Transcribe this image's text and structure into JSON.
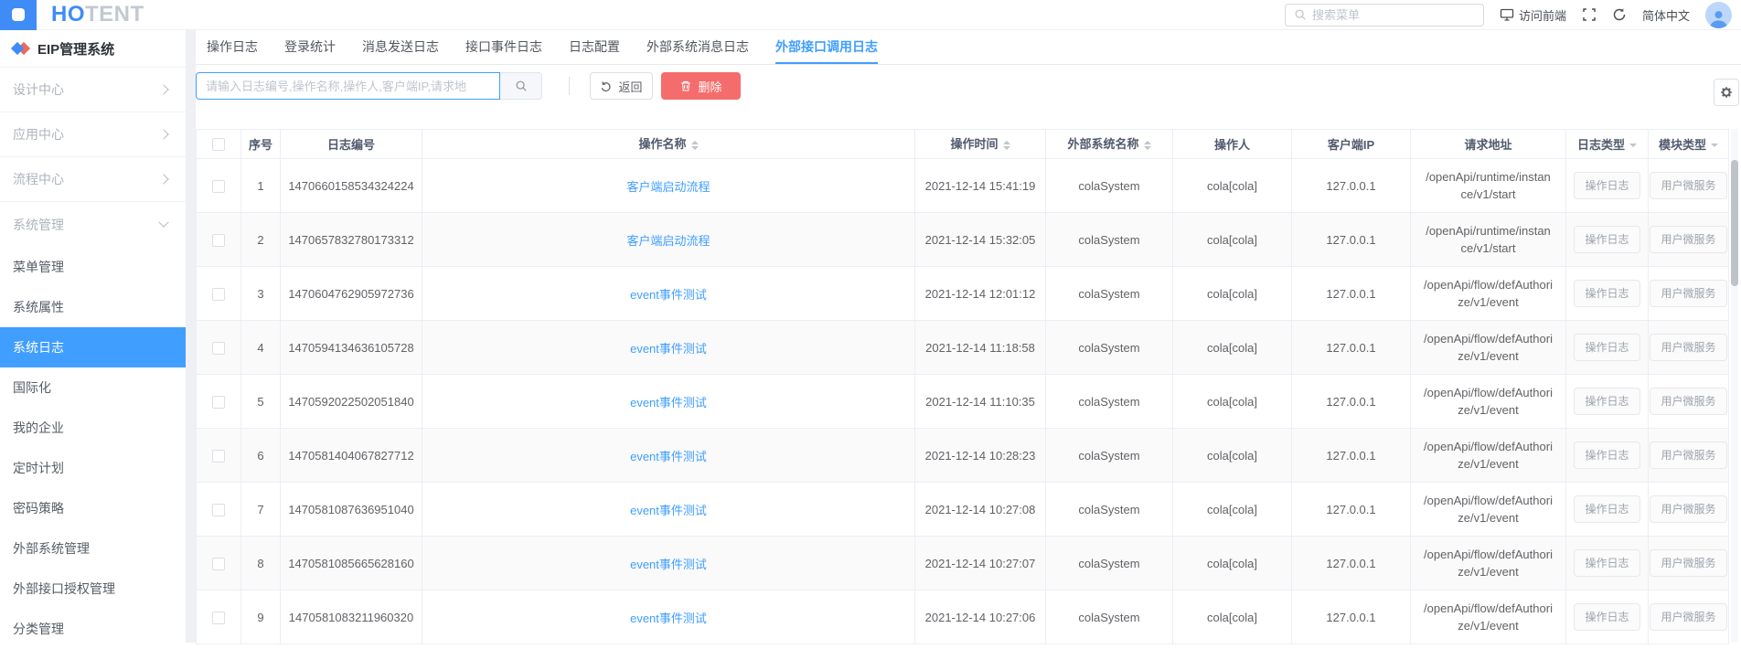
{
  "colors": {
    "primary": "#409eff",
    "danger": "#f56c6c",
    "sidebar_active_bg": "#409eff",
    "link": "#409eff"
  },
  "topbar": {
    "logo_primary": "HO",
    "logo_secondary": "TENT",
    "menu_search_placeholder": "搜索菜单",
    "visit_frontend_label": "访问前端",
    "language_label": "简体中文"
  },
  "sidebar": {
    "app_title": "EIP管理系统",
    "groups": [
      {
        "id": "design-center",
        "label": "设计中心",
        "expanded": false
      },
      {
        "id": "app-center",
        "label": "应用中心",
        "expanded": false
      },
      {
        "id": "flow-center",
        "label": "流程中心",
        "expanded": false
      },
      {
        "id": "system-management",
        "label": "系统管理",
        "expanded": true
      }
    ],
    "menu_items": [
      {
        "id": "menu-management",
        "label": "菜单管理",
        "active": false
      },
      {
        "id": "system-properties",
        "label": "系统属性",
        "active": false
      },
      {
        "id": "system-log",
        "label": "系统日志",
        "active": true
      },
      {
        "id": "i18n",
        "label": "国际化",
        "active": false
      },
      {
        "id": "my-enterprise",
        "label": "我的企业",
        "active": false
      },
      {
        "id": "scheduled-tasks",
        "label": "定时计划",
        "active": false
      },
      {
        "id": "password-policy",
        "label": "密码策略",
        "active": false
      },
      {
        "id": "external-system-management",
        "label": "外部系统管理",
        "active": false
      },
      {
        "id": "external-api-auth-management",
        "label": "外部接口授权管理",
        "active": false
      },
      {
        "id": "category-management",
        "label": "分类管理",
        "active": false
      }
    ]
  },
  "tabs": [
    {
      "id": "operation-log",
      "label": "操作日志",
      "active": false
    },
    {
      "id": "login-stats",
      "label": "登录统计",
      "active": false
    },
    {
      "id": "message-send-log",
      "label": "消息发送日志",
      "active": false
    },
    {
      "id": "interface-event-log",
      "label": "接口事件日志",
      "active": false
    },
    {
      "id": "log-config",
      "label": "日志配置",
      "active": false
    },
    {
      "id": "external-system-message-log",
      "label": "外部系统消息日志",
      "active": false
    },
    {
      "id": "external-api-call-log",
      "label": "外部接口调用日志",
      "active": true
    }
  ],
  "toolbar": {
    "log_search_placeholder": "请输入日志编号,操作名称,操作人,客户端IP,请求地",
    "back_label": "返回",
    "delete_label": "删除"
  },
  "table": {
    "columns": [
      {
        "id": "select",
        "label": "",
        "type": "checkbox"
      },
      {
        "id": "index",
        "label": "序号"
      },
      {
        "id": "log-id",
        "label": "日志编号"
      },
      {
        "id": "operation-name",
        "label": "操作名称",
        "sortable": true
      },
      {
        "id": "operation-time",
        "label": "操作时间",
        "sortable": true
      },
      {
        "id": "external-system",
        "label": "外部系统名称",
        "sortable": true
      },
      {
        "id": "operator",
        "label": "操作人"
      },
      {
        "id": "client-ip",
        "label": "客户端IP"
      },
      {
        "id": "request-url",
        "label": "请求地址"
      },
      {
        "id": "log-type",
        "label": "日志类型",
        "filterable": true
      },
      {
        "id": "module-type",
        "label": "模块类型",
        "filterable": true
      }
    ],
    "rows": [
      {
        "index": 1,
        "log_id": "1470660158534324224",
        "operation_name": "客户端启动流程",
        "operation_time": "2021-12-14 15:41:19",
        "external_system": "colaSystem",
        "operator": "cola[cola]",
        "client_ip": "127.0.0.1",
        "request_url": "/openApi/runtime/instance/v1/start",
        "log_type": "操作日志",
        "module_type": "用户微服务"
      },
      {
        "index": 2,
        "log_id": "1470657832780173312",
        "operation_name": "客户端启动流程",
        "operation_time": "2021-12-14 15:32:05",
        "external_system": "colaSystem",
        "operator": "cola[cola]",
        "client_ip": "127.0.0.1",
        "request_url": "/openApi/runtime/instance/v1/start",
        "log_type": "操作日志",
        "module_type": "用户微服务"
      },
      {
        "index": 3,
        "log_id": "1470604762905972736",
        "operation_name": "event事件测试",
        "operation_time": "2021-12-14 12:01:12",
        "external_system": "colaSystem",
        "operator": "cola[cola]",
        "client_ip": "127.0.0.1",
        "request_url": "/openApi/flow/defAuthorize/v1/event",
        "log_type": "操作日志",
        "module_type": "用户微服务"
      },
      {
        "index": 4,
        "log_id": "1470594134636105728",
        "operation_name": "event事件测试",
        "operation_time": "2021-12-14 11:18:58",
        "external_system": "colaSystem",
        "operator": "cola[cola]",
        "client_ip": "127.0.0.1",
        "request_url": "/openApi/flow/defAuthorize/v1/event",
        "log_type": "操作日志",
        "module_type": "用户微服务"
      },
      {
        "index": 5,
        "log_id": "1470592022502051840",
        "operation_name": "event事件测试",
        "operation_time": "2021-12-14 11:10:35",
        "external_system": "colaSystem",
        "operator": "cola[cola]",
        "client_ip": "127.0.0.1",
        "request_url": "/openApi/flow/defAuthorize/v1/event",
        "log_type": "操作日志",
        "module_type": "用户微服务"
      },
      {
        "index": 6,
        "log_id": "1470581404067827712",
        "operation_name": "event事件测试",
        "operation_time": "2021-12-14 10:28:23",
        "external_system": "colaSystem",
        "operator": "cola[cola]",
        "client_ip": "127.0.0.1",
        "request_url": "/openApi/flow/defAuthorize/v1/event",
        "log_type": "操作日志",
        "module_type": "用户微服务"
      },
      {
        "index": 7,
        "log_id": "1470581087636951040",
        "operation_name": "event事件测试",
        "operation_time": "2021-12-14 10:27:08",
        "external_system": "colaSystem",
        "operator": "cola[cola]",
        "client_ip": "127.0.0.1",
        "request_url": "/openApi/flow/defAuthorize/v1/event",
        "log_type": "操作日志",
        "module_type": "用户微服务"
      },
      {
        "index": 8,
        "log_id": "1470581085665628160",
        "operation_name": "event事件测试",
        "operation_time": "2021-12-14 10:27:07",
        "external_system": "colaSystem",
        "operator": "cola[cola]",
        "client_ip": "127.0.0.1",
        "request_url": "/openApi/flow/defAuthorize/v1/event",
        "log_type": "操作日志",
        "module_type": "用户微服务"
      },
      {
        "index": 9,
        "log_id": "1470581083211960320",
        "operation_name": "event事件测试",
        "operation_time": "2021-12-14 10:27:06",
        "external_system": "colaSystem",
        "operator": "cola[cola]",
        "client_ip": "127.0.0.1",
        "request_url": "/openApi/flow/defAuthorize/v1/event",
        "log_type": "操作日志",
        "module_type": "用户微服务"
      }
    ]
  }
}
